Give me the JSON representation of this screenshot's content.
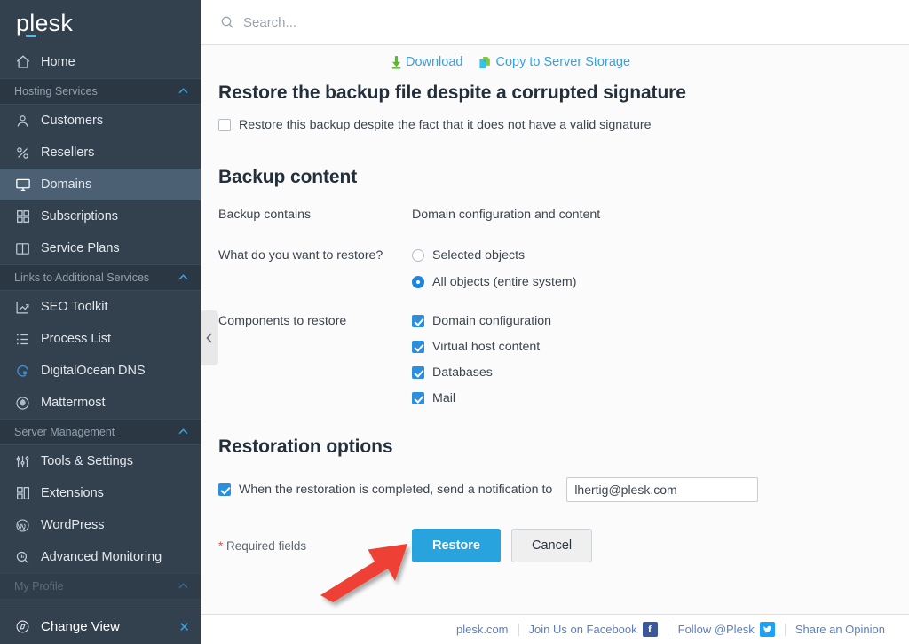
{
  "brand": {
    "logo_text": "plesk",
    "accent": "#53bce6"
  },
  "sidebar": {
    "items": [
      {
        "type": "item",
        "label": "Home",
        "icon": "home-icon"
      },
      {
        "type": "section",
        "label": "Hosting Services",
        "icon": "chevron-up-icon"
      },
      {
        "type": "item",
        "label": "Customers",
        "icon": "user-icon"
      },
      {
        "type": "item",
        "label": "Resellers",
        "icon": "percent-icon"
      },
      {
        "type": "item",
        "label": "Domains",
        "icon": "monitor-icon",
        "active": true
      },
      {
        "type": "item",
        "label": "Subscriptions",
        "icon": "grid-icon"
      },
      {
        "type": "item",
        "label": "Service Plans",
        "icon": "book-icon"
      },
      {
        "type": "section",
        "label": "Links to Additional Services",
        "icon": "chevron-up-icon"
      },
      {
        "type": "item",
        "label": "SEO Toolkit",
        "icon": "chart-arrow-icon"
      },
      {
        "type": "item",
        "label": "Process List",
        "icon": "list-icon"
      },
      {
        "type": "item",
        "label": "DigitalOcean DNS",
        "icon": "digitalocean-icon"
      },
      {
        "type": "item",
        "label": "Mattermost",
        "icon": "mattermost-icon"
      },
      {
        "type": "section",
        "label": "Server Management",
        "icon": "chevron-up-icon"
      },
      {
        "type": "item",
        "label": "Tools & Settings",
        "icon": "sliders-icon"
      },
      {
        "type": "item",
        "label": "Extensions",
        "icon": "extensions-icon"
      },
      {
        "type": "item",
        "label": "WordPress",
        "icon": "wordpress-icon"
      },
      {
        "type": "item",
        "label": "Advanced Monitoring",
        "icon": "magnifier-chart-icon"
      },
      {
        "type": "section",
        "label": "My Profile",
        "icon": "chevron-up-icon",
        "faded": true
      }
    ],
    "change_view": {
      "label": "Change View",
      "icon": "compass-icon",
      "close_icon": "close-icon"
    },
    "collapse_handle_icon": "chevron-left-icon",
    "active_bg": "#4c6074",
    "bg": "#33414f"
  },
  "search": {
    "placeholder": "Search...",
    "value": "",
    "icon": "search-icon"
  },
  "toolbar": {
    "download": {
      "label": "Download",
      "icon": "download-arrow-icon",
      "color": "#3c9fe0"
    },
    "copy_to_storage": {
      "label": "Copy to Server Storage",
      "icon": "copy-document-icon",
      "color": "#3c9fe0"
    }
  },
  "signature_section": {
    "heading": "Restore the backup file despite a corrupted signature",
    "checkbox": {
      "label": "Restore this backup despite the fact that it does not have a valid signature",
      "checked": false
    }
  },
  "backup_content": {
    "heading": "Backup content",
    "contains_label": "Backup contains",
    "contains_value": "Domain configuration and content",
    "restore_question_label": "What do you want to restore?",
    "restore_options": [
      {
        "label": "Selected objects",
        "selected": false
      },
      {
        "label": "All objects (entire system)",
        "selected": true
      }
    ],
    "components_label": "Components to restore",
    "components": [
      {
        "label": "Domain configuration",
        "checked": true
      },
      {
        "label": "Virtual host content",
        "checked": true
      },
      {
        "label": "Databases",
        "checked": true
      },
      {
        "label": "Mail",
        "checked": true
      }
    ]
  },
  "restoration_options": {
    "heading": "Restoration options",
    "notify": {
      "label": "When the restoration is completed, send a notification to",
      "checked": true
    },
    "email": {
      "value": "lhertig@plesk.com",
      "placeholder": ""
    }
  },
  "form_footer": {
    "required_star": "*",
    "required_label": "Required fields",
    "restore_button": "Restore",
    "cancel_button": "Cancel",
    "primary_color": "#28a3dd"
  },
  "footer_links": [
    {
      "label": "plesk.com",
      "icon": null
    },
    {
      "label": "Join Us on Facebook",
      "icon": "facebook-icon"
    },
    {
      "label": "Follow @Plesk",
      "icon": "twitter-icon"
    },
    {
      "label": "Share an Opinion",
      "icon": null
    }
  ],
  "annotation": {
    "type": "arrow",
    "color": "#ef3e36",
    "points_to": "restore-button"
  }
}
